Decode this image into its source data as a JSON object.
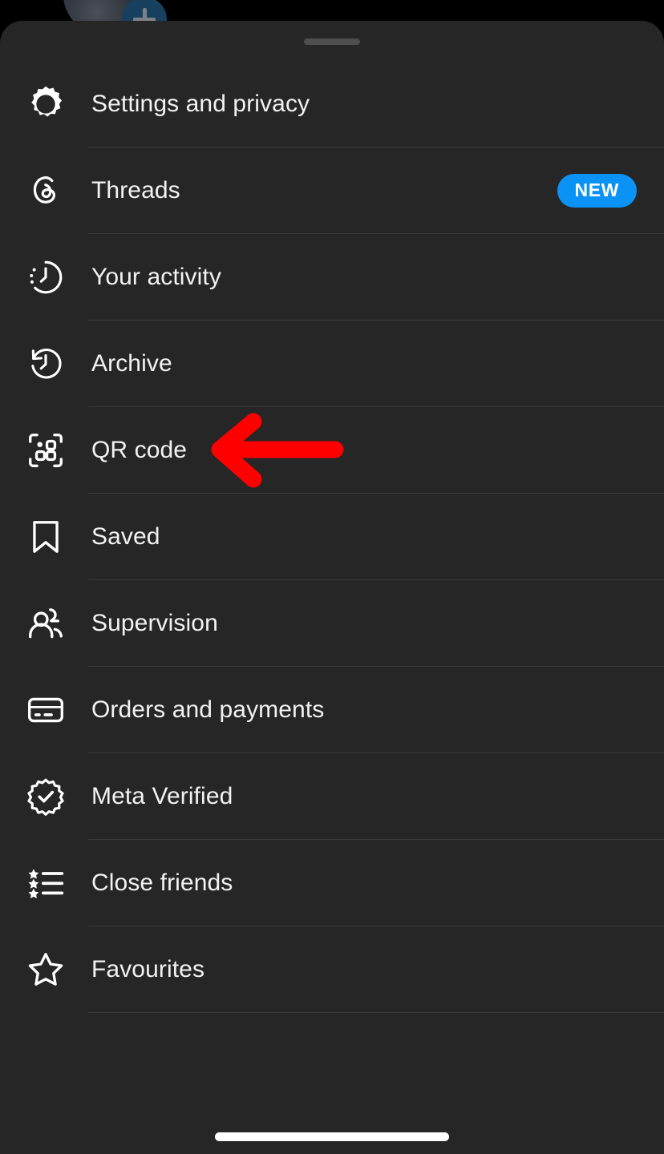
{
  "sheet": {
    "background_color": "#262626",
    "handle_color": "#4e4e4e",
    "divider_color": "#3a3a3a",
    "accent_blue": "#0a93f5",
    "annotation_color": "#ff0000",
    "text_color": "#f2f2f2"
  },
  "background": {
    "plus_badge_icon": "plus-icon",
    "avatar_icon": "avatar-image"
  },
  "menu": {
    "items": [
      {
        "id": "settings-and-privacy",
        "label": "Settings and privacy",
        "icon": "gear-icon",
        "badge": null
      },
      {
        "id": "threads",
        "label": "Threads",
        "icon": "threads-icon",
        "badge": "NEW"
      },
      {
        "id": "your-activity",
        "label": "Your activity",
        "icon": "activity-clock-icon",
        "badge": null
      },
      {
        "id": "archive",
        "label": "Archive",
        "icon": "archive-clock-icon",
        "badge": null
      },
      {
        "id": "qr-code",
        "label": "QR code",
        "icon": "qr-code-icon",
        "badge": null
      },
      {
        "id": "saved",
        "label": "Saved",
        "icon": "bookmark-icon",
        "badge": null
      },
      {
        "id": "supervision",
        "label": "Supervision",
        "icon": "people-icon",
        "badge": null
      },
      {
        "id": "orders-and-payments",
        "label": "Orders and payments",
        "icon": "credit-card-icon",
        "badge": null
      },
      {
        "id": "meta-verified",
        "label": "Meta Verified",
        "icon": "verified-badge-icon",
        "badge": null
      },
      {
        "id": "close-friends",
        "label": "Close friends",
        "icon": "star-list-icon",
        "badge": null
      },
      {
        "id": "favourites",
        "label": "Favourites",
        "icon": "star-outline-icon",
        "badge": null
      }
    ]
  },
  "annotation": {
    "type": "arrow-left",
    "points_to": "qr-code",
    "color": "#ff0000"
  },
  "system": {
    "home_indicator": "home-indicator-bar"
  }
}
